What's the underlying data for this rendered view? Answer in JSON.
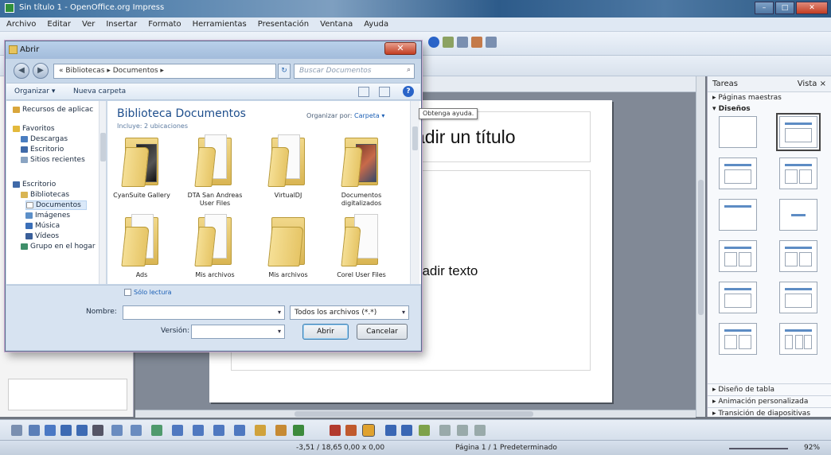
{
  "window": {
    "title": "Sin título 1 - OpenOffice.org Impress",
    "minimize": "–",
    "maximize": "□",
    "close": "✕"
  },
  "menu": [
    "Archivo",
    "Editar",
    "Ver",
    "Insertar",
    "Formato",
    "Herramientas",
    "Presentación",
    "Ventana",
    "Ayuda"
  ],
  "slide": {
    "title_placeholder": "adir un título",
    "body_placeholder": "ñadir texto"
  },
  "tasks_pane": {
    "title": "Tareas",
    "view_label": "Vista",
    "close": "×",
    "sections": {
      "master_pages": "Páginas maestras",
      "layouts": "Diseños",
      "table_design": "Diseño de tabla",
      "custom_animation": "Animación personalizada",
      "slide_transition": "Transición de diapositivas"
    }
  },
  "statusbar": {
    "position": "-3,51 / 18,65",
    "size": "0,00 x 0,00",
    "page": "Página 1 / 1",
    "master": "Predeterminado",
    "zoom": "92%"
  },
  "dialog": {
    "title": "Abrir",
    "close": "✕",
    "address": "« Bibliotecas ▸ Documentos ▸",
    "search_placeholder": "Buscar Documentos",
    "organize": "Organizar ▾",
    "new_folder": "Nueva carpeta",
    "tooltip": "Obtenga ayuda.",
    "nav": {
      "recent_apps": "Recursos de aplicac",
      "favorites": "Favoritos",
      "downloads": "Descargas",
      "desktop_fav": "Escritorio",
      "recent_places": "Sitios recientes",
      "desktop": "Escritorio",
      "libraries": "Bibliotecas",
      "documents": "Documentos",
      "images": "Imágenes",
      "music": "Música",
      "videos": "Vídeos",
      "homegroup": "Grupo en el hogar"
    },
    "library_title": "Biblioteca Documentos",
    "library_sub": "Incluye: 2 ubicaciones",
    "arrange_label": "Organizar por:",
    "arrange_value": "Carpeta ▾",
    "folders": [
      "CyanSuite Gallery",
      "DTA San Andreas User Files",
      "VirtualDJ",
      "Documentos digitalizados",
      "Ads",
      "Mis archivos",
      "Mis archivos",
      "Corel User Files"
    ],
    "read_only": "Sólo lectura",
    "filename_label": "Nombre:",
    "filename_value": "",
    "filetype": "Todos los archivos (*.*)",
    "version_label": "Versión:",
    "version_value": "",
    "open_btn": "Abrir",
    "cancel_btn": "Cancelar"
  }
}
